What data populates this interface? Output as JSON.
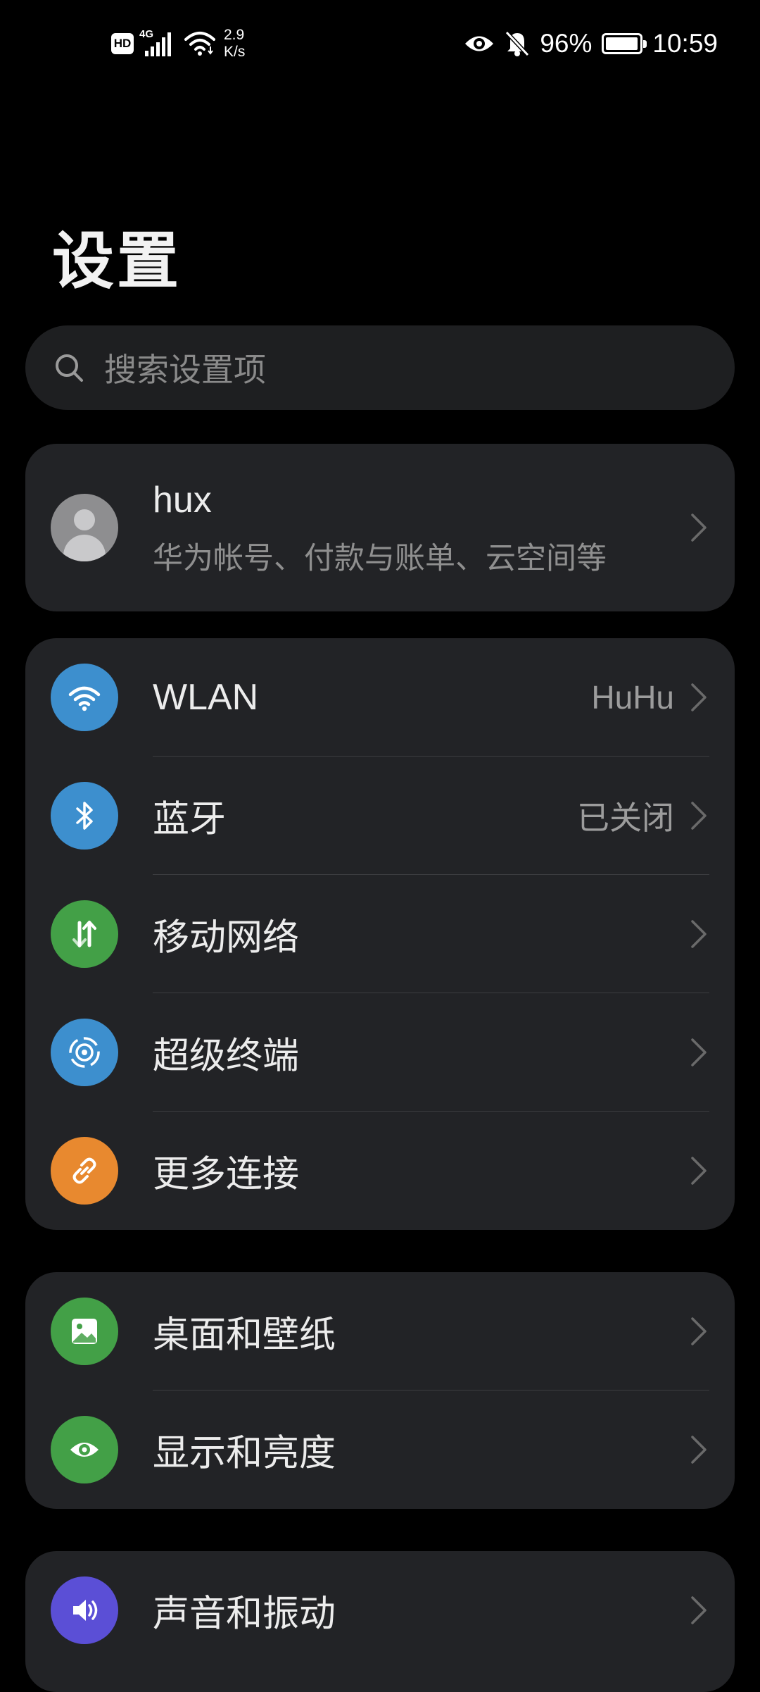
{
  "status_bar": {
    "hd": "HD",
    "network_type": "4G",
    "speed_value": "2.9",
    "speed_unit": "K/s",
    "battery": "96%",
    "battery_level": 0.96,
    "time": "10:59"
  },
  "title": "设置",
  "search": {
    "placeholder": "搜索设置项"
  },
  "account": {
    "name": "hux",
    "subtitle": "华为帐号、付款与账单、云空间等"
  },
  "connectivity": [
    {
      "label": "WLAN",
      "value": "HuHu",
      "icon": "wifi-icon",
      "color": "#3d8fce"
    },
    {
      "label": "蓝牙",
      "value": "已关闭",
      "icon": "bluetooth-icon",
      "color": "#3d8fce"
    },
    {
      "label": "移动网络",
      "value": "",
      "icon": "mobile-data-icon",
      "color": "#43a047"
    },
    {
      "label": "超级终端",
      "value": "",
      "icon": "super-device-icon",
      "color": "#3d8fce"
    },
    {
      "label": "更多连接",
      "value": "",
      "icon": "link-icon",
      "color": "#e8892f"
    }
  ],
  "display": [
    {
      "label": "桌面和壁纸",
      "icon": "wallpaper-icon",
      "color": "#43a047"
    },
    {
      "label": "显示和亮度",
      "icon": "eye-icon",
      "color": "#43a047"
    }
  ],
  "sound": [
    {
      "label": "声音和振动",
      "icon": "speaker-icon",
      "color": "#5b4fd6"
    }
  ]
}
